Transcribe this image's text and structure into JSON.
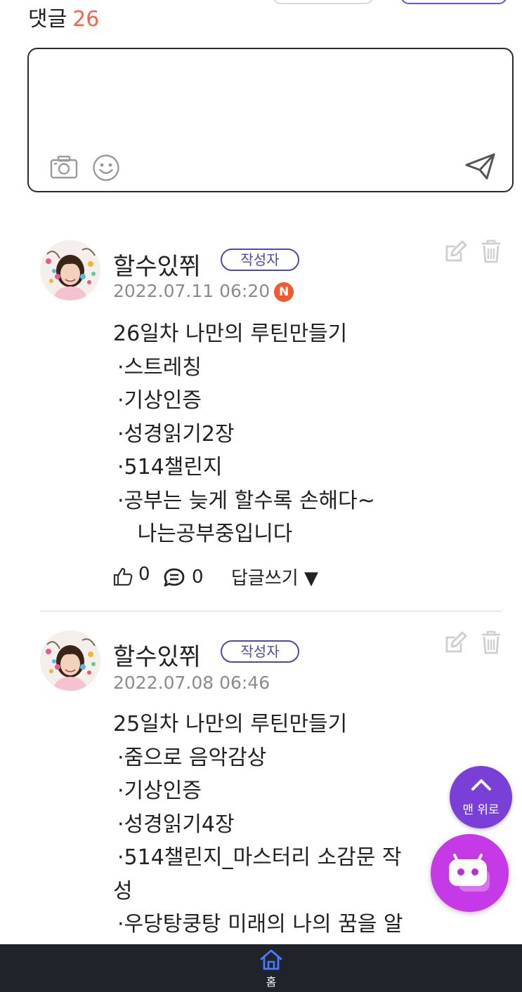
{
  "header": {
    "comments_label": "댓글",
    "comments_count": "26"
  },
  "comment_input": {
    "placeholder": ""
  },
  "comments": [
    {
      "nickname": "할수있쮜",
      "author_badge": "작성자",
      "date": "2022.07.11 06:20",
      "new_badge": "N",
      "lines": [
        "26일차 나만의 루틴만들기",
        "·스트레칭",
        "·기상인증",
        "·성경읽기2장",
        "·514챌린지",
        "·공부는 늦게 할수록 손해다~",
        "   나는공부중입니다"
      ],
      "like_count": "0",
      "reply_count": "0",
      "reply_label": "답글쓰기 ▼"
    },
    {
      "nickname": "할수있쮜",
      "author_badge": "작성자",
      "date": "2022.07.08 06:46",
      "lines": [
        "25일차 나만의 루틴만들기",
        "·줌으로 음악감상",
        "·기상인증",
        "·성경읽기4장",
        "·514챌린지_마스터리 소감문 작",
        "성",
        "·우당탕쿵탕 미래의 나의 꿈을 알"
      ]
    }
  ],
  "floating": {
    "top_button_label": "맨 위로"
  },
  "bottom_nav": {
    "home_label": "홈"
  },
  "colors": {
    "accent_purple": "#7a3fd6",
    "chat_magenta": "#c53ae6",
    "count_orange": "#ec6a4b",
    "new_red": "#f15a2b",
    "nav_dark": "#1f232a"
  }
}
